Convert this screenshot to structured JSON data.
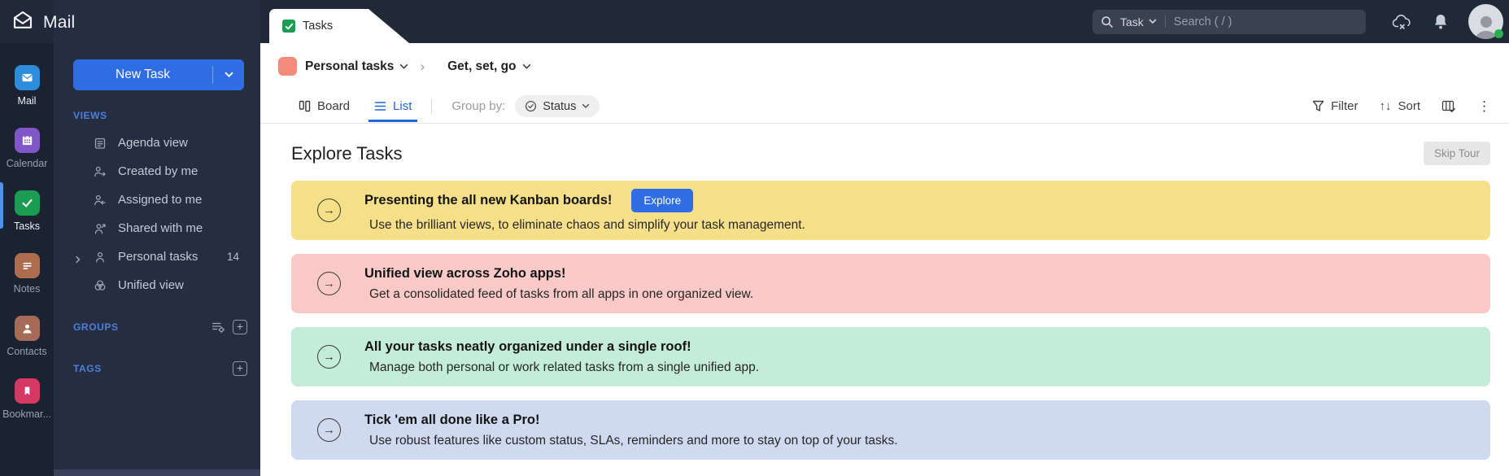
{
  "brand": {
    "name": "Mail"
  },
  "topbar": {
    "search_scope": "Task",
    "search_placeholder": "Search ( / )"
  },
  "rail": {
    "items": [
      {
        "label": "Mail"
      },
      {
        "label": "Calendar"
      },
      {
        "label": "Tasks"
      },
      {
        "label": "Notes"
      },
      {
        "label": "Contacts"
      },
      {
        "label": "Bookmar..."
      }
    ]
  },
  "sidebar": {
    "new_task_label": "New Task",
    "views_label": "VIEWS",
    "views": [
      {
        "label": "Agenda view"
      },
      {
        "label": "Created by me"
      },
      {
        "label": "Assigned to me"
      },
      {
        "label": "Shared with me"
      },
      {
        "label": "Personal tasks",
        "count": "14"
      },
      {
        "label": "Unified view"
      }
    ],
    "groups_label": "GROUPS",
    "tags_label": "TAGS"
  },
  "tab": {
    "label": "Tasks"
  },
  "breadcrumb": {
    "folder": "Personal tasks",
    "view": "Get, set, go"
  },
  "toolbar": {
    "board_label": "Board",
    "list_label": "List",
    "group_by_label": "Group by:",
    "group_by_value": "Status",
    "filter_label": "Filter",
    "sort_label": "Sort"
  },
  "content": {
    "heading": "Explore Tasks",
    "skip_tour_label": "Skip Tour",
    "banners": [
      {
        "title": "Presenting the all new Kanban boards!",
        "subtitle": "Use the brilliant views, to eliminate chaos and simplify your task management.",
        "button": "Explore",
        "bg": "#f5e089"
      },
      {
        "title": "Unified view across Zoho apps!",
        "subtitle": "Get a consolidated feed of tasks from all apps in one organized view.",
        "bg": "#f9c9c8"
      },
      {
        "title": "All your tasks neatly organized under a single roof!",
        "subtitle": "Manage both personal or work related tasks from a single unified app.",
        "bg": "#c3ecd9"
      },
      {
        "title": "Tick 'em all done like a Pro!",
        "subtitle": "Use robust features like custom status, SLAs, reminders and more to stay on top of your tasks.",
        "bg": "#cfd9ef"
      }
    ]
  },
  "icons": {
    "kebab": "⋮",
    "sort_arrows": "↑↓",
    "breadcrumb_separator": "›",
    "banner_arrow": "→",
    "plus": "+"
  },
  "colors": {
    "accent": "#2e6de4",
    "active_indicator": "#4d94f0",
    "tasks_green": "#189d52"
  }
}
